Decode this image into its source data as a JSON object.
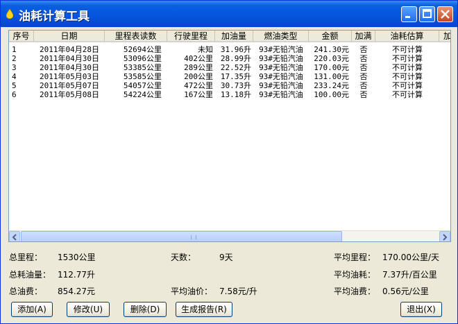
{
  "window": {
    "title": "油耗计算工具"
  },
  "table": {
    "columns": [
      "序号",
      "日期",
      "里程表读数",
      "行驶里程",
      "加油量",
      "燃油类型",
      "金额",
      "加满",
      "油耗估算",
      "加"
    ],
    "rows": [
      [
        "1",
        "2011年04月28日",
        "52694公里",
        "未知",
        "31.96升",
        "93#无铅汽油",
        "241.30元",
        "否",
        "不可计算"
      ],
      [
        "2",
        "2011年04月30日",
        "53096公里",
        "402公里",
        "28.99升",
        "93#无铅汽油",
        "220.03元",
        "否",
        "不可计算"
      ],
      [
        "3",
        "2011年04月30日",
        "53385公里",
        "289公里",
        "22.52升",
        "93#无铅汽油",
        "170.00元",
        "否",
        "不可计算"
      ],
      [
        "4",
        "2011年05月03日",
        "53585公里",
        "200公里",
        "17.35升",
        "93#无铅汽油",
        "131.00元",
        "否",
        "不可计算"
      ],
      [
        "5",
        "2011年05月07日",
        "54057公里",
        "472公里",
        "30.73升",
        "93#无铅汽油",
        "233.24元",
        "否",
        "不可计算"
      ],
      [
        "6",
        "2011年05月08日",
        "54224公里",
        "167公里",
        "13.18升",
        "93#无铅汽油",
        "100.00元",
        "否",
        "不可计算"
      ]
    ]
  },
  "stats": {
    "total_mileage_label": "总里程：",
    "total_mileage_value": "1530公里",
    "days_label": "天数：",
    "days_value": "9天",
    "avg_mileage_label": "平均里程：",
    "avg_mileage_value": "170.00公里/天",
    "total_fuel_label": "总耗油量：",
    "total_fuel_value": "112.77升",
    "avg_consumption_label": "平均油耗：",
    "avg_consumption_value": "7.37升/百公里",
    "total_cost_label": "总油费：",
    "total_cost_value": "854.27元",
    "avg_price_label": "平均油价：",
    "avg_price_value": "7.58元/升",
    "avg_fuel_cost_label": "平均油费：",
    "avg_fuel_cost_value": "0.56元/公里"
  },
  "buttons": {
    "add": "添加(A)",
    "edit": "修改(U)",
    "delete": "删除(D)",
    "report": "生成报告(R)",
    "exit": "退出(X)"
  },
  "colors": {
    "titlebar": "#0554dd",
    "window_bg": "#ece9d8",
    "border": "#7f9db9"
  }
}
